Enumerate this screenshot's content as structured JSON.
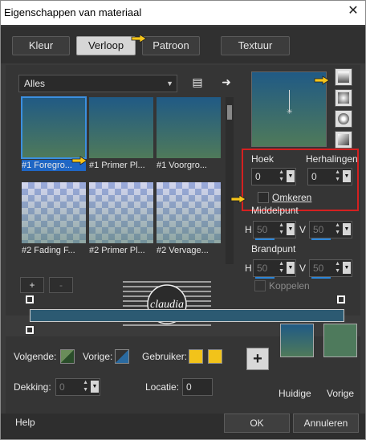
{
  "window": {
    "title": "Eigenschappen van materiaal",
    "close": "✕"
  },
  "tabs": [
    {
      "label": "Kleur"
    },
    {
      "label": "Verloop"
    },
    {
      "label": "Patroon"
    },
    {
      "label": "Textuur"
    }
  ],
  "category": {
    "selected": "Alles"
  },
  "gradients": [
    {
      "label": "#1 Foregro..."
    },
    {
      "label": "#1 Primer Pl..."
    },
    {
      "label": "#1 Voorgro..."
    },
    {
      "label": "#2 Fading F..."
    },
    {
      "label": "#2 Primer Pl..."
    },
    {
      "label": "#2 Vervage..."
    }
  ],
  "controls": {
    "angle_label": "Hoek",
    "angle_value": "0",
    "repeats_label": "Herhalingen",
    "repeats_value": "0",
    "invert_label": "Omkeren",
    "center_label": "Middelpunt",
    "center_h_label": "H",
    "center_h_value": "50",
    "center_v_label": "V",
    "center_v_value": "50",
    "focal_label": "Brandpunt",
    "focal_h_label": "H",
    "focal_h_value": "50",
    "focal_v_label": "V",
    "focal_v_value": "50",
    "link_label": "Koppelen"
  },
  "editor": {
    "add": "+",
    "remove": "-"
  },
  "bottom": {
    "follow_label": "Volgende:",
    "prev_label": "Vorige:",
    "user_label": "Gebruiker:",
    "opacity_label": "Dekking:",
    "opacity_value": "0",
    "location_label": "Locatie:",
    "location_value": "0",
    "current_label": "Huidige",
    "previous_label": "Vorige",
    "add_symbol": "+"
  },
  "footer": {
    "help": "Help",
    "ok": "OK",
    "cancel": "Annuleren"
  },
  "watermark": {
    "text": "claudia"
  },
  "colors": {
    "gradient_top": "#205a85",
    "gradient_bottom": "#4f7a5a",
    "selection_blue": "#1f66c4",
    "highlight_red": "#d42020",
    "user_yellow": "#f2c31a",
    "previous_green": "#4e7a5c"
  },
  "icons": {
    "close": "close-icon",
    "list_view": "list-view-icon",
    "arrow_right": "arrow-right-icon",
    "hand_pointer": "pointing-hand-icon"
  }
}
